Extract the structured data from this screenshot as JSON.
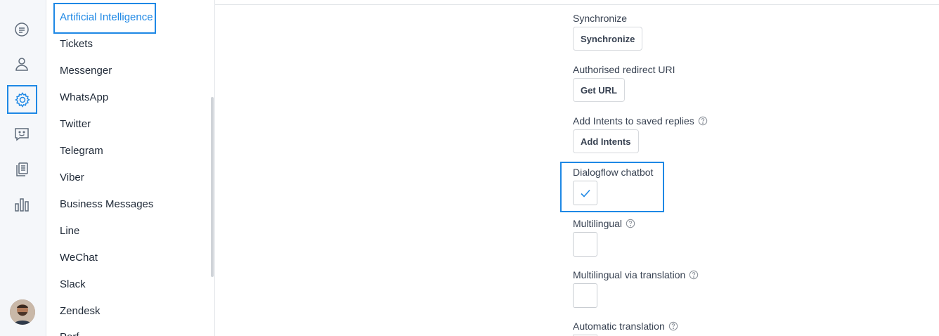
{
  "nav": {
    "items": [
      {
        "label": "Artificial Intelligence",
        "active": true
      },
      {
        "label": "Tickets"
      },
      {
        "label": "Messenger"
      },
      {
        "label": "WhatsApp"
      },
      {
        "label": "Twitter"
      },
      {
        "label": "Telegram"
      },
      {
        "label": "Viber"
      },
      {
        "label": "Business Messages"
      },
      {
        "label": "Line"
      },
      {
        "label": "WeChat"
      },
      {
        "label": "Slack"
      },
      {
        "label": "Zendesk"
      },
      {
        "label": "Perf"
      }
    ]
  },
  "rail": {
    "icons": [
      "conversations-icon",
      "user-icon",
      "settings-icon",
      "chatbot-icon",
      "articles-icon",
      "reports-icon"
    ],
    "active": "settings-icon"
  },
  "settings": {
    "synchronize": {
      "label": "Synchronize",
      "button": "Synchronize"
    },
    "redirect_uri": {
      "label": "Authorised redirect URI",
      "button": "Get URL"
    },
    "intents": {
      "label": "Add Intents to saved replies",
      "button": "Add Intents"
    },
    "dialogflow_chatbot": {
      "label": "Dialogflow chatbot",
      "checked": true
    },
    "multilingual": {
      "label": "Multilingual",
      "checked": false
    },
    "multilingual_translation": {
      "label": "Multilingual via translation",
      "checked": false
    },
    "automatic_translation": {
      "label": "Automatic translation"
    }
  },
  "colors": {
    "accent": "#1e88e5",
    "rail_bg": "#f5f7fa"
  }
}
